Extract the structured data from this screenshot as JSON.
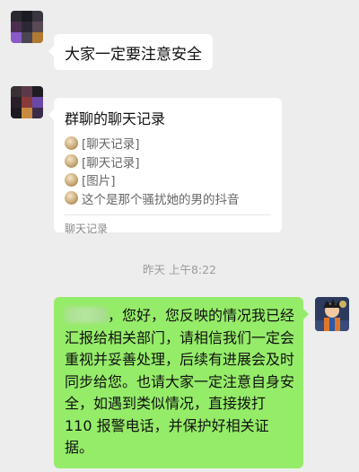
{
  "chat": {
    "messages": [
      {
        "side": "left",
        "type": "text",
        "text": "大家一定要注意安全"
      },
      {
        "side": "left",
        "type": "chat-record-card",
        "title": "群聊的聊天记录",
        "lines": [
          "[聊天记录]",
          "[聊天记录]",
          "[图片]",
          "这个是那个骚扰她的男的抖音"
        ],
        "footer": "聊天记录"
      },
      {
        "type": "timestamp",
        "text": "昨天 上午8:22"
      },
      {
        "side": "right",
        "type": "text",
        "text": "，您好，您反映的情况我已经汇报给相关部门，请相信我们一定会重视并妥善处理，后续有进展会及时同步给您。也请大家一定注意自身安全，如遇到类似情况，直接拨打 110 报警电话，并保护好相关证据。"
      }
    ]
  },
  "colors": {
    "background": "#ededed",
    "bubble_left": "#ffffff",
    "bubble_right": "#95ec69"
  }
}
